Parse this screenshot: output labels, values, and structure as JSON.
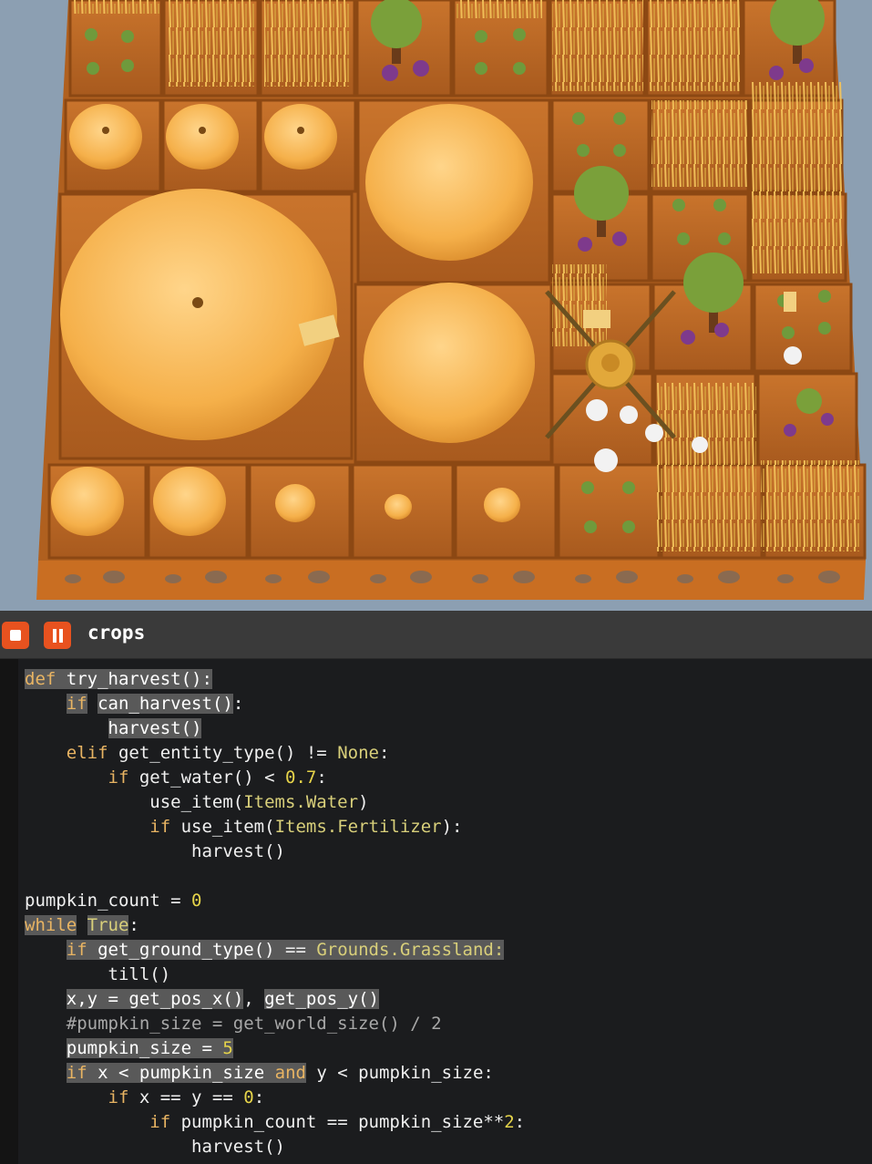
{
  "panel": {
    "title": "crops",
    "stop_icon": "stop-icon",
    "pause_icon": "pause-icon"
  },
  "colors": {
    "accent_button": "#e8521f",
    "panel_header": "#3a3a3a",
    "editor_bg": "#1b1c1e",
    "keyword": "#e8b463",
    "number": "#e6d44a",
    "comment": "#a8a8a8",
    "highlight": "#595959"
  },
  "code": {
    "lines": [
      [
        {
          "t": "def",
          "c": "kw",
          "h": 1
        },
        {
          "t": " ",
          "c": "plain",
          "h": 1
        },
        {
          "t": "try_harvest():",
          "c": "fn",
          "h": 1
        }
      ],
      [
        {
          "t": "    ",
          "c": "plain"
        },
        {
          "t": "if",
          "c": "kw",
          "h": 1
        },
        {
          "t": " ",
          "c": "plain"
        },
        {
          "t": "can_harvest",
          "c": "fn",
          "h": 1
        },
        {
          "t": "()",
          "c": "op",
          "h": 1
        },
        {
          "t": ":",
          "c": "op"
        }
      ],
      [
        {
          "t": "        ",
          "c": "plain"
        },
        {
          "t": "harvest",
          "c": "fn",
          "h": 1
        },
        {
          "t": "()",
          "c": "op",
          "h": 1
        }
      ],
      [
        {
          "t": "    ",
          "c": "plain"
        },
        {
          "t": "elif",
          "c": "kw"
        },
        {
          "t": " get_entity_type() != ",
          "c": "plain"
        },
        {
          "t": "None",
          "c": "cls"
        },
        {
          "t": ":",
          "c": "plain"
        }
      ],
      [
        {
          "t": "        ",
          "c": "plain"
        },
        {
          "t": "if",
          "c": "kw"
        },
        {
          "t": " get_water() < ",
          "c": "plain"
        },
        {
          "t": "0.7",
          "c": "num"
        },
        {
          "t": ":",
          "c": "plain"
        }
      ],
      [
        {
          "t": "            ",
          "c": "plain"
        },
        {
          "t": "use_item(",
          "c": "plain"
        },
        {
          "t": "Items.Water",
          "c": "cls"
        },
        {
          "t": ")",
          "c": "plain"
        }
      ],
      [
        {
          "t": "            ",
          "c": "plain"
        },
        {
          "t": "if",
          "c": "kw"
        },
        {
          "t": " use_item(",
          "c": "plain"
        },
        {
          "t": "Items.Fertilizer",
          "c": "cls"
        },
        {
          "t": "):",
          "c": "plain"
        }
      ],
      [
        {
          "t": "                ",
          "c": "plain"
        },
        {
          "t": "harvest()",
          "c": "plain"
        }
      ],
      [
        {
          "t": "",
          "c": "plain"
        }
      ],
      [
        {
          "t": "pumpkin_count = ",
          "c": "plain"
        },
        {
          "t": "0",
          "c": "num"
        }
      ],
      [
        {
          "t": "while",
          "c": "kw",
          "h": 1
        },
        {
          "t": " ",
          "c": "plain"
        },
        {
          "t": "True",
          "c": "cls",
          "h": 1
        },
        {
          "t": ":",
          "c": "plain"
        }
      ],
      [
        {
          "t": "    ",
          "c": "plain"
        },
        {
          "t": "if",
          "c": "kw",
          "h": 1
        },
        {
          "t": " ",
          "c": "plain",
          "h": 1
        },
        {
          "t": "get_ground_type",
          "c": "fn",
          "h": 1
        },
        {
          "t": "()",
          "c": "op",
          "h": 1
        },
        {
          "t": " == ",
          "c": "plain",
          "h": 1
        },
        {
          "t": "Grounds.Grassland:",
          "c": "cls",
          "h": 1
        }
      ],
      [
        {
          "t": "        ",
          "c": "plain"
        },
        {
          "t": "till()",
          "c": "plain"
        }
      ],
      [
        {
          "t": "    ",
          "c": "plain"
        },
        {
          "t": "x,y",
          "c": "fn",
          "h": 1
        },
        {
          "t": " = ",
          "c": "op",
          "h": 1
        },
        {
          "t": "get_pos_x",
          "c": "fn",
          "h": 1
        },
        {
          "t": "()",
          "c": "op",
          "h": 1
        },
        {
          "t": ", ",
          "c": "plain"
        },
        {
          "t": "get_pos_y",
          "c": "fn",
          "h": 1
        },
        {
          "t": "()",
          "c": "op",
          "h": 1
        }
      ],
      [
        {
          "t": "    ",
          "c": "plain"
        },
        {
          "t": "#pumpkin_size = get_world_size() / 2",
          "c": "cmt"
        }
      ],
      [
        {
          "t": "    ",
          "c": "plain"
        },
        {
          "t": "pumpkin_size",
          "c": "fn",
          "h": 1
        },
        {
          "t": " = ",
          "c": "op",
          "h": 1
        },
        {
          "t": "5",
          "c": "num",
          "h": 1
        }
      ],
      [
        {
          "t": "    ",
          "c": "plain"
        },
        {
          "t": "if",
          "c": "kw",
          "h": 1
        },
        {
          "t": " ",
          "c": "plain",
          "h": 1
        },
        {
          "t": "x",
          "c": "fn",
          "h": 1
        },
        {
          "t": " < ",
          "c": "op",
          "h": 1
        },
        {
          "t": "pumpkin_size",
          "c": "fn",
          "h": 1
        },
        {
          "t": " ",
          "c": "plain",
          "h": 1
        },
        {
          "t": "and",
          "c": "kw",
          "h": 1
        },
        {
          "t": " y < pumpkin_size:",
          "c": "plain"
        }
      ],
      [
        {
          "t": "        ",
          "c": "plain"
        },
        {
          "t": "if",
          "c": "kw"
        },
        {
          "t": " x == y == ",
          "c": "plain"
        },
        {
          "t": "0",
          "c": "num"
        },
        {
          "t": ":",
          "c": "plain"
        }
      ],
      [
        {
          "t": "            ",
          "c": "plain"
        },
        {
          "t": "if",
          "c": "kw"
        },
        {
          "t": " pumpkin_count == pumpkin_size**",
          "c": "plain"
        },
        {
          "t": "2",
          "c": "num"
        },
        {
          "t": ":",
          "c": "plain"
        }
      ],
      [
        {
          "t": "                ",
          "c": "plain"
        },
        {
          "t": "harvest()",
          "c": "plain"
        }
      ]
    ]
  }
}
